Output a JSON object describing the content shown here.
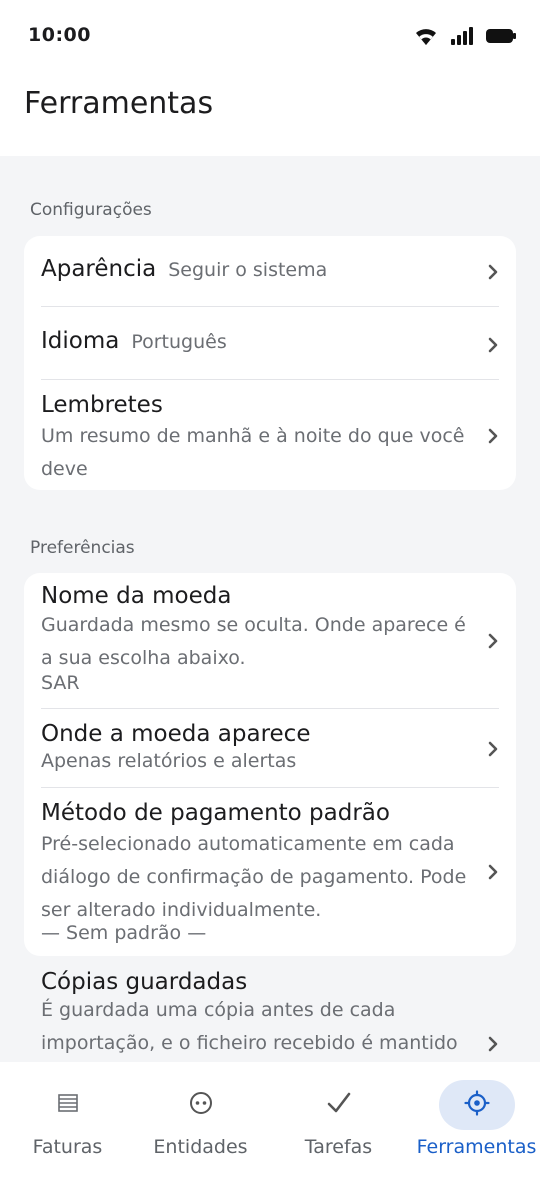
{
  "status_bar": {
    "time": "10:00"
  },
  "header": {
    "title": "Ferramentas"
  },
  "sections": [
    {
      "label": "Configurações",
      "items": [
        {
          "title": "Aparência",
          "value": "Seguir o sistema"
        },
        {
          "title": "Idioma",
          "value": "Português"
        },
        {
          "title": "Lembretes",
          "subtitle_lines": [
            "Um resumo de manhã e à noite do que você",
            "deve"
          ]
        }
      ]
    },
    {
      "label": "Preferências",
      "items": [
        {
          "title": "Nome da moeda",
          "subtitle_lines": [
            "Guardada mesmo se oculta. Onde aparece é",
            "a sua escolha abaixo."
          ],
          "value": "SAR"
        },
        {
          "title": "Onde a moeda aparece",
          "subtitle_lines": [
            "Apenas relatórios e alertas"
          ]
        },
        {
          "title": "Método de pagamento padrão",
          "subtitle_lines": [
            "Pré-selecionado automaticamente em cada",
            "diálogo de confirmação de pagamento. Pode",
            "ser alterado individualmente."
          ],
          "value": "— Sem padrão —"
        },
        {
          "title": "Cópias guardadas",
          "subtitle_lines": [
            "É guardada uma cópia antes de cada",
            "importação, e o ficheiro recebido é mantido"
          ]
        }
      ]
    }
  ],
  "bottom_nav": {
    "items": [
      {
        "label": "Faturas",
        "icon": "invoice-list-icon",
        "active": false
      },
      {
        "label": "Entidades",
        "icon": "entity-face-icon",
        "active": false
      },
      {
        "label": "Tarefas",
        "icon": "check-icon",
        "active": false
      },
      {
        "label": "Ferramentas",
        "icon": "gear-icon",
        "active": true
      }
    ],
    "active_color": "#1a5fc8",
    "active_bg": "#dfe8f7"
  }
}
